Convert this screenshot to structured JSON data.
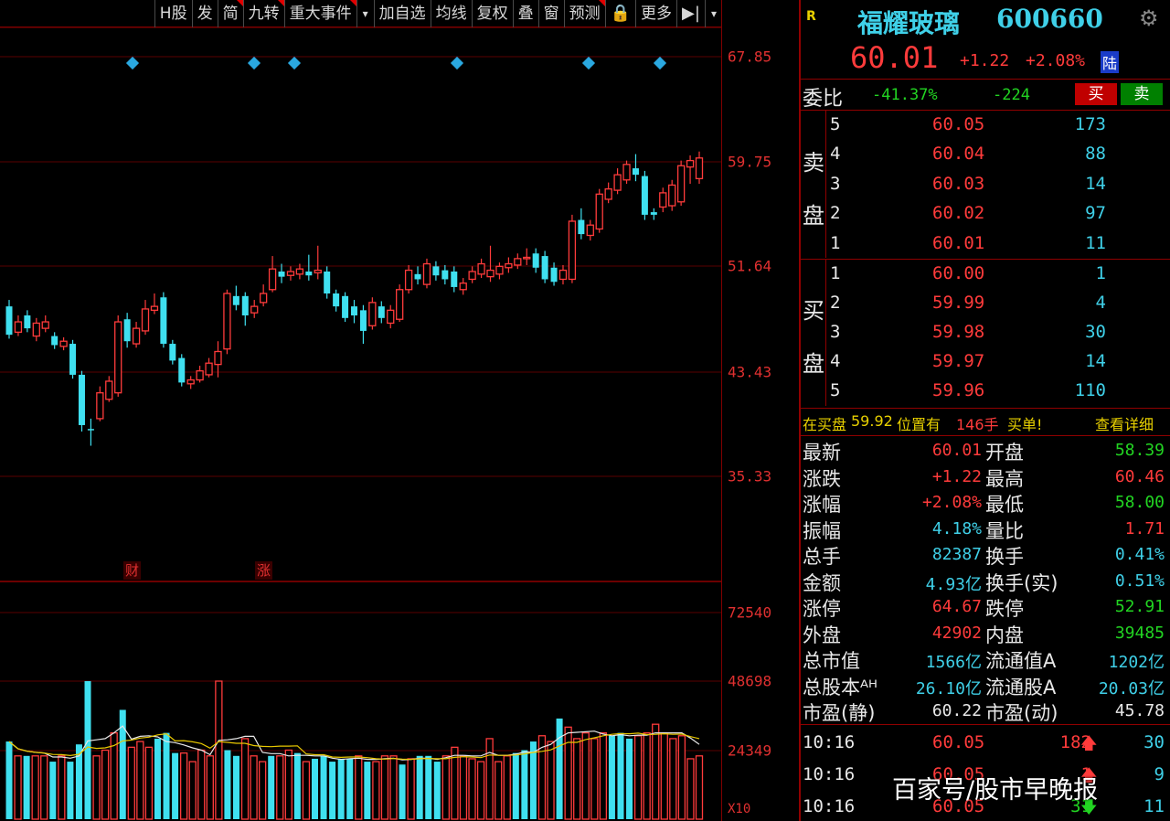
{
  "toolbar": {
    "items": [
      "H股",
      "发",
      "简",
      "九转",
      "重大事件",
      "▾",
      "加自选",
      "均线",
      "复权",
      "叠",
      "窗",
      "预测",
      "🔒",
      "更多",
      "▶|",
      "▾"
    ]
  },
  "chart": {
    "price_labels": [
      "67.85",
      "59.75",
      "51.64",
      "43.43",
      "35.33"
    ],
    "volume_labels": [
      "72540",
      "48698",
      "24349",
      "X10"
    ],
    "markers": [
      "财",
      "涨"
    ]
  },
  "chart_data": {
    "type": "candlestick",
    "ylim": [
      35.33,
      67.85
    ],
    "candles": [
      {
        "o": 48.5,
        "c": 46.3,
        "h": 49.0,
        "l": 46.0
      },
      {
        "o": 46.5,
        "c": 47.3,
        "h": 47.8,
        "l": 46.2
      },
      {
        "o": 47.8,
        "c": 46.8,
        "h": 48.2,
        "l": 46.5
      },
      {
        "o": 46.2,
        "c": 47.2,
        "h": 47.6,
        "l": 45.8
      },
      {
        "o": 46.8,
        "c": 47.3,
        "h": 47.8,
        "l": 46.5
      },
      {
        "o": 46.2,
        "c": 45.5,
        "h": 46.5,
        "l": 45.2
      },
      {
        "o": 45.4,
        "c": 45.8,
        "h": 46.1,
        "l": 45.1
      },
      {
        "o": 45.6,
        "c": 43.2,
        "h": 45.9,
        "l": 42.9
      },
      {
        "o": 43.2,
        "c": 39.3,
        "h": 43.5,
        "l": 38.8
      },
      {
        "o": 39.0,
        "c": 38.9,
        "h": 39.8,
        "l": 37.7
      },
      {
        "o": 39.8,
        "c": 41.8,
        "h": 42.3,
        "l": 39.6
      },
      {
        "o": 41.3,
        "c": 42.7,
        "h": 43.1,
        "l": 41.1
      },
      {
        "o": 41.8,
        "c": 47.3,
        "h": 47.8,
        "l": 41.5
      },
      {
        "o": 47.5,
        "c": 45.8,
        "h": 48.0,
        "l": 45.3
      },
      {
        "o": 45.6,
        "c": 46.8,
        "h": 47.3,
        "l": 45.3
      },
      {
        "o": 46.6,
        "c": 48.3,
        "h": 49.0,
        "l": 46.3
      },
      {
        "o": 48.2,
        "c": 48.5,
        "h": 49.5,
        "l": 47.9
      },
      {
        "o": 49.2,
        "c": 45.6,
        "h": 49.6,
        "l": 45.3
      },
      {
        "o": 45.6,
        "c": 44.3,
        "h": 45.9,
        "l": 44.0
      },
      {
        "o": 44.5,
        "c": 42.6,
        "h": 44.8,
        "l": 42.3
      },
      {
        "o": 42.5,
        "c": 42.8,
        "h": 43.1,
        "l": 42.1
      },
      {
        "o": 42.8,
        "c": 43.5,
        "h": 43.9,
        "l": 42.6
      },
      {
        "o": 43.2,
        "c": 44.1,
        "h": 44.5,
        "l": 43.0
      },
      {
        "o": 44.0,
        "c": 45.0,
        "h": 45.8,
        "l": 43.0
      },
      {
        "o": 45.2,
        "c": 49.5,
        "h": 49.8,
        "l": 44.8
      },
      {
        "o": 49.3,
        "c": 48.6,
        "h": 50.1,
        "l": 48.2
      },
      {
        "o": 49.3,
        "c": 47.8,
        "h": 49.6,
        "l": 47.0
      },
      {
        "o": 48.0,
        "c": 48.5,
        "h": 49.0,
        "l": 47.6
      },
      {
        "o": 48.8,
        "c": 49.5,
        "h": 50.2,
        "l": 48.5
      },
      {
        "o": 49.8,
        "c": 51.4,
        "h": 52.4,
        "l": 49.6
      },
      {
        "o": 51.2,
        "c": 50.8,
        "h": 51.8,
        "l": 50.3
      },
      {
        "o": 50.9,
        "c": 51.2,
        "h": 51.6,
        "l": 50.5
      },
      {
        "o": 51.0,
        "c": 51.4,
        "h": 51.8,
        "l": 50.6
      },
      {
        "o": 51.2,
        "c": 50.9,
        "h": 52.5,
        "l": 50.5
      },
      {
        "o": 51.1,
        "c": 51.3,
        "h": 53.2,
        "l": 50.6
      },
      {
        "o": 51.2,
        "c": 49.5,
        "h": 51.6,
        "l": 49.1
      },
      {
        "o": 49.5,
        "c": 48.5,
        "h": 49.8,
        "l": 48.1
      },
      {
        "o": 49.3,
        "c": 47.6,
        "h": 49.6,
        "l": 47.3
      },
      {
        "o": 48.5,
        "c": 47.8,
        "h": 49.0,
        "l": 47.2
      },
      {
        "o": 48.2,
        "c": 46.6,
        "h": 48.6,
        "l": 45.6
      },
      {
        "o": 47.0,
        "c": 48.8,
        "h": 49.2,
        "l": 46.7
      },
      {
        "o": 48.5,
        "c": 47.6,
        "h": 48.9,
        "l": 47.2
      },
      {
        "o": 47.2,
        "c": 48.2,
        "h": 48.6,
        "l": 46.8
      },
      {
        "o": 47.5,
        "c": 49.8,
        "h": 50.2,
        "l": 47.3
      },
      {
        "o": 49.8,
        "c": 51.3,
        "h": 51.7,
        "l": 49.5
      },
      {
        "o": 51.0,
        "c": 50.6,
        "h": 51.6,
        "l": 50.2
      },
      {
        "o": 50.2,
        "c": 51.8,
        "h": 52.2,
        "l": 49.9
      },
      {
        "o": 51.6,
        "c": 50.9,
        "h": 52.0,
        "l": 50.5
      },
      {
        "o": 51.3,
        "c": 50.6,
        "h": 51.7,
        "l": 50.2
      },
      {
        "o": 51.2,
        "c": 50.0,
        "h": 51.6,
        "l": 49.6
      },
      {
        "o": 49.8,
        "c": 50.3,
        "h": 50.7,
        "l": 49.4
      },
      {
        "o": 50.6,
        "c": 51.2,
        "h": 51.6,
        "l": 50.3
      },
      {
        "o": 51.0,
        "c": 51.8,
        "h": 52.2,
        "l": 50.7
      },
      {
        "o": 50.8,
        "c": 51.3,
        "h": 53.2,
        "l": 50.4
      },
      {
        "o": 51.0,
        "c": 51.6,
        "h": 51.9,
        "l": 50.6
      },
      {
        "o": 51.5,
        "c": 51.8,
        "h": 52.3,
        "l": 51.1
      },
      {
        "o": 51.7,
        "c": 52.2,
        "h": 52.6,
        "l": 51.4
      },
      {
        "o": 52.2,
        "c": 52.3,
        "h": 53.0,
        "l": 51.7
      },
      {
        "o": 52.6,
        "c": 51.5,
        "h": 53.0,
        "l": 51.1
      },
      {
        "o": 52.4,
        "c": 50.6,
        "h": 52.8,
        "l": 50.3
      },
      {
        "o": 51.5,
        "c": 50.4,
        "h": 51.9,
        "l": 50.1
      },
      {
        "o": 50.6,
        "c": 51.3,
        "h": 51.7,
        "l": 50.2
      },
      {
        "o": 50.6,
        "c": 55.1,
        "h": 55.6,
        "l": 50.3
      },
      {
        "o": 55.2,
        "c": 54.1,
        "h": 56.1,
        "l": 53.7
      },
      {
        "o": 54.0,
        "c": 54.8,
        "h": 55.2,
        "l": 53.6
      },
      {
        "o": 54.5,
        "c": 57.2,
        "h": 57.6,
        "l": 54.2
      },
      {
        "o": 56.8,
        "c": 57.6,
        "h": 58.1,
        "l": 56.5
      },
      {
        "o": 57.5,
        "c": 58.7,
        "h": 59.2,
        "l": 57.2
      },
      {
        "o": 58.3,
        "c": 59.5,
        "h": 59.8,
        "l": 58.0
      },
      {
        "o": 59.2,
        "c": 58.7,
        "h": 60.3,
        "l": 58.2
      },
      {
        "o": 58.6,
        "c": 55.6,
        "h": 59.0,
        "l": 55.2
      },
      {
        "o": 55.8,
        "c": 55.6,
        "h": 56.1,
        "l": 55.2
      },
      {
        "o": 56.2,
        "c": 57.3,
        "h": 57.7,
        "l": 55.8
      },
      {
        "o": 56.3,
        "c": 57.9,
        "h": 58.3,
        "l": 55.9
      },
      {
        "o": 56.6,
        "c": 59.4,
        "h": 59.8,
        "l": 56.3
      },
      {
        "o": 59.3,
        "c": 59.8,
        "h": 60.2,
        "l": 58.0
      },
      {
        "o": 58.4,
        "c": 60.0,
        "h": 60.5,
        "l": 58.0
      }
    ],
    "volumes": [
      27,
      22,
      22,
      22,
      22,
      20,
      22,
      20,
      26,
      48,
      22,
      24,
      30,
      38,
      25,
      27,
      25,
      28,
      30,
      23,
      23,
      20,
      24,
      22,
      48,
      24,
      22,
      28,
      22,
      20,
      22,
      22,
      24,
      23,
      20,
      21,
      22,
      20,
      21,
      21,
      22,
      20,
      20,
      22,
      22,
      19,
      21,
      22,
      22,
      20,
      22,
      25,
      22,
      21,
      20,
      28,
      20,
      22,
      23,
      24,
      27,
      29,
      27,
      35,
      32,
      28,
      30,
      28,
      30,
      29,
      30,
      28,
      29,
      30,
      33,
      30,
      28,
      29,
      21,
      22
    ],
    "volume_ylim": [
      0,
      72540
    ]
  },
  "stock": {
    "flag": "R",
    "name": "福耀玻璃",
    "code": "600660",
    "price": "60.01",
    "change": "+1.22",
    "pct": "+2.08%",
    "tag": "陆"
  },
  "weibi": {
    "label": "委比",
    "ratio": "-41.37%",
    "diff": "-224",
    "buy_btn": "买",
    "sell_btn": "卖"
  },
  "sell_label_1": "卖",
  "sell_label_2": "盘",
  "buy_label_1": "买",
  "buy_label_2": "盘",
  "sell_orders": [
    {
      "level": "5",
      "price": "60.05",
      "vol": "173"
    },
    {
      "level": "4",
      "price": "60.04",
      "vol": "88"
    },
    {
      "level": "3",
      "price": "60.03",
      "vol": "14"
    },
    {
      "level": "2",
      "price": "60.02",
      "vol": "97"
    },
    {
      "level": "1",
      "price": "60.01",
      "vol": "11"
    }
  ],
  "buy_orders": [
    {
      "level": "1",
      "price": "60.00",
      "vol": "1"
    },
    {
      "level": "2",
      "price": "59.99",
      "vol": "4"
    },
    {
      "level": "3",
      "price": "59.98",
      "vol": "30"
    },
    {
      "level": "4",
      "price": "59.97",
      "vol": "14"
    },
    {
      "level": "5",
      "price": "59.96",
      "vol": "110"
    }
  ],
  "notice": {
    "text1": "在买盘",
    "price": "59.92",
    "text2": "位置有",
    "qty": "146手",
    "text3": "买单!",
    "link": "查看详细"
  },
  "stats": [
    {
      "l1": "最新",
      "v1": "60.01",
      "c1": "red",
      "l2": "开盘",
      "v2": "58.39",
      "c2": "green"
    },
    {
      "l1": "涨跌",
      "v1": "+1.22",
      "c1": "red",
      "l2": "最高",
      "v2": "60.46",
      "c2": "red"
    },
    {
      "l1": "涨幅",
      "v1": "+2.08%",
      "c1": "red",
      "l2": "最低",
      "v2": "58.00",
      "c2": "green"
    },
    {
      "l1": "振幅",
      "v1": "4.18%",
      "c1": "cyan",
      "l2": "量比",
      "v2": "1.71",
      "c2": "red"
    },
    {
      "l1": "总手",
      "v1": "82387",
      "c1": "cyan",
      "l2": "换手",
      "v2": "0.41%",
      "c2": "cyan"
    },
    {
      "l1": "金额",
      "v1": "4.93亿",
      "c1": "cyan",
      "l2": "换手(实)",
      "v2": "0.51%",
      "c2": "cyan"
    },
    {
      "l1": "涨停",
      "v1": "64.67",
      "c1": "red",
      "l2": "跌停",
      "v2": "52.91",
      "c2": "green"
    },
    {
      "l1": "外盘",
      "v1": "42902",
      "c1": "red",
      "l2": "内盘",
      "v2": "39485",
      "c2": "green"
    },
    {
      "l1": "总市值",
      "v1": "1566亿",
      "c1": "cyan",
      "l2": "流通值A",
      "v2": "1202亿",
      "c2": "cyan"
    },
    {
      "l1": "总股本ᴬᴴ",
      "v1": "26.10亿",
      "c1": "cyan",
      "l2": "流通股A",
      "v2": "20.03亿",
      "c2": "cyan"
    },
    {
      "l1": "市盈(静)",
      "v1": "60.22",
      "c1": "white",
      "l2": "市盈(动)",
      "v2": "45.78",
      "c2": "white"
    }
  ],
  "ticks": [
    {
      "time": "10:16",
      "price": "60.05",
      "vol": "182",
      "dir": "up",
      "num": "30"
    },
    {
      "time": "10:16",
      "price": "60.05",
      "vol": "1",
      "dir": "up",
      "num": "9"
    },
    {
      "time": "10:16",
      "price": "60.05",
      "vol": "31",
      "dir": "down",
      "num": "11"
    }
  ],
  "watermark": "百家号/股市早晚报"
}
